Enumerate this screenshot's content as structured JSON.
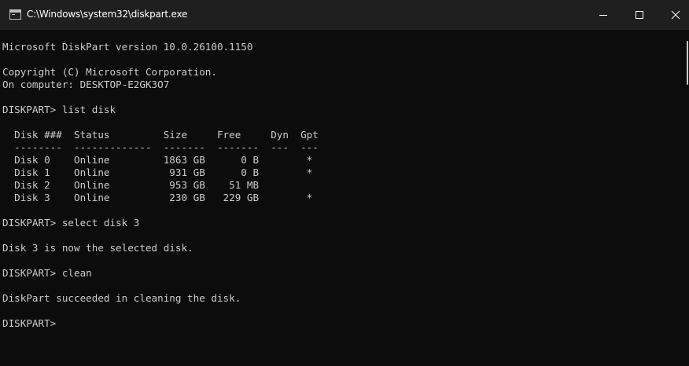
{
  "window": {
    "title": "C:\\Windows\\system32\\diskpart.exe"
  },
  "console": {
    "lines": [
      "Microsoft DiskPart version 10.0.26100.1150",
      "",
      "Copyright (C) Microsoft Corporation.",
      "On computer: DESKTOP-E2GK3O7",
      "",
      "DISKPART> list disk",
      "",
      "  Disk ###  Status         Size     Free     Dyn  Gpt",
      "  --------  -------------  -------  -------  ---  ---",
      "  Disk 0    Online         1863 GB      0 B        *",
      "  Disk 1    Online          931 GB      0 B        *",
      "  Disk 2    Online          953 GB    51 MB",
      "  Disk 3    Online          230 GB   229 GB        *",
      "",
      "DISKPART> select disk 3",
      "",
      "Disk 3 is now the selected disk.",
      "",
      "DISKPART> clean",
      "",
      "DiskPart succeeded in cleaning the disk.",
      "",
      "DISKPART> "
    ]
  }
}
